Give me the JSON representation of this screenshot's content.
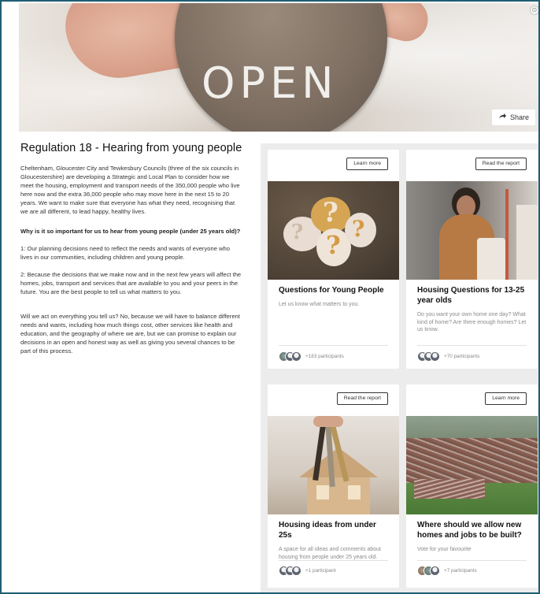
{
  "hero": {
    "sign_text": "OPEN",
    "share_label": "Share",
    "share_icon": "share-arrow-icon"
  },
  "intro": {
    "title": "Regulation 18 - Hearing from young people",
    "p1": "Cheltenham, Gloucester City and Tewkesbury Councils (three of the six councils in Gloucestershire) are developing a Strategic and Local Plan to consider how we meet the housing, employment and transport needs of the 350,000 people who live here now and the extra 36,000 people who may move here in the next 15 to 20 years. We want to make sure that everyone has what they need, recognising that we are all different, to lead happy, healthy lives.",
    "question": "Why is it so important for us to hear from young people (under 25 years old)?",
    "p2": "1: Our planning decisions need to reflect the needs and wants of everyone who lives in our communities, including children and young people.",
    "p3": "2: Because the decisions that we make now and in the next few years will affect the homes, jobs, transport and services that are available to you and your peers in the future. You are the best people to tell us what matters to you.",
    "p4": "Will we act on everything you tell us? No, because we will have to balance different needs and wants, including how much things cost, other services like health and education, and the geography of where we are, but we can promise to explain our decisions in an open and honest way as well as giving you several chances to be part of this process."
  },
  "cards": [
    {
      "button": "Learn more",
      "title": "Questions for Young People",
      "description": "Let us know what matters to you.",
      "participants": "+183 participants"
    },
    {
      "button": "Read the report",
      "title": "Housing Questions for 13-25 year olds",
      "description": "Do you want your own home one day? What kind of home? Are there enough homes? Let us know.",
      "participants": "+70 participants"
    },
    {
      "button": "Read the report",
      "title": "Housing ideas from under 25s",
      "description": "A space for all ideas and comments about housing from people under 25 years old.",
      "participants": "+1 participant"
    },
    {
      "button": "Learn more",
      "title": "Where should we allow new homes and jobs to be built?",
      "description": "Vote for your favourite",
      "participants": "+7 participants"
    }
  ]
}
